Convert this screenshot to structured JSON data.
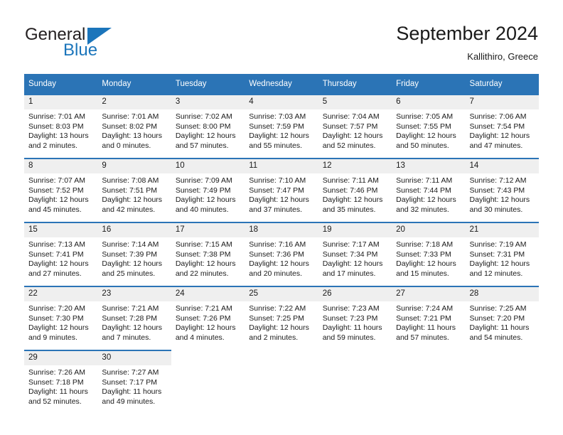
{
  "brand": {
    "name_part1": "General",
    "name_part2": "Blue",
    "accent_color": "#1b75bb"
  },
  "header": {
    "title": "September 2024",
    "location": "Kallithiro, Greece"
  },
  "theme": {
    "header_blue": "#2b74b6",
    "daynum_background": "#efefef",
    "text_color": "#1a1a1a"
  },
  "weekday_headers": [
    "Sunday",
    "Monday",
    "Tuesday",
    "Wednesday",
    "Thursday",
    "Friday",
    "Saturday"
  ],
  "weeks": [
    [
      {
        "day": "1",
        "sunrise": "Sunrise: 7:01 AM",
        "sunset": "Sunset: 8:03 PM",
        "daylight": "Daylight: 13 hours and 2 minutes."
      },
      {
        "day": "2",
        "sunrise": "Sunrise: 7:01 AM",
        "sunset": "Sunset: 8:02 PM",
        "daylight": "Daylight: 13 hours and 0 minutes."
      },
      {
        "day": "3",
        "sunrise": "Sunrise: 7:02 AM",
        "sunset": "Sunset: 8:00 PM",
        "daylight": "Daylight: 12 hours and 57 minutes."
      },
      {
        "day": "4",
        "sunrise": "Sunrise: 7:03 AM",
        "sunset": "Sunset: 7:59 PM",
        "daylight": "Daylight: 12 hours and 55 minutes."
      },
      {
        "day": "5",
        "sunrise": "Sunrise: 7:04 AM",
        "sunset": "Sunset: 7:57 PM",
        "daylight": "Daylight: 12 hours and 52 minutes."
      },
      {
        "day": "6",
        "sunrise": "Sunrise: 7:05 AM",
        "sunset": "Sunset: 7:55 PM",
        "daylight": "Daylight: 12 hours and 50 minutes."
      },
      {
        "day": "7",
        "sunrise": "Sunrise: 7:06 AM",
        "sunset": "Sunset: 7:54 PM",
        "daylight": "Daylight: 12 hours and 47 minutes."
      }
    ],
    [
      {
        "day": "8",
        "sunrise": "Sunrise: 7:07 AM",
        "sunset": "Sunset: 7:52 PM",
        "daylight": "Daylight: 12 hours and 45 minutes."
      },
      {
        "day": "9",
        "sunrise": "Sunrise: 7:08 AM",
        "sunset": "Sunset: 7:51 PM",
        "daylight": "Daylight: 12 hours and 42 minutes."
      },
      {
        "day": "10",
        "sunrise": "Sunrise: 7:09 AM",
        "sunset": "Sunset: 7:49 PM",
        "daylight": "Daylight: 12 hours and 40 minutes."
      },
      {
        "day": "11",
        "sunrise": "Sunrise: 7:10 AM",
        "sunset": "Sunset: 7:47 PM",
        "daylight": "Daylight: 12 hours and 37 minutes."
      },
      {
        "day": "12",
        "sunrise": "Sunrise: 7:11 AM",
        "sunset": "Sunset: 7:46 PM",
        "daylight": "Daylight: 12 hours and 35 minutes."
      },
      {
        "day": "13",
        "sunrise": "Sunrise: 7:11 AM",
        "sunset": "Sunset: 7:44 PM",
        "daylight": "Daylight: 12 hours and 32 minutes."
      },
      {
        "day": "14",
        "sunrise": "Sunrise: 7:12 AM",
        "sunset": "Sunset: 7:43 PM",
        "daylight": "Daylight: 12 hours and 30 minutes."
      }
    ],
    [
      {
        "day": "15",
        "sunrise": "Sunrise: 7:13 AM",
        "sunset": "Sunset: 7:41 PM",
        "daylight": "Daylight: 12 hours and 27 minutes."
      },
      {
        "day": "16",
        "sunrise": "Sunrise: 7:14 AM",
        "sunset": "Sunset: 7:39 PM",
        "daylight": "Daylight: 12 hours and 25 minutes."
      },
      {
        "day": "17",
        "sunrise": "Sunrise: 7:15 AM",
        "sunset": "Sunset: 7:38 PM",
        "daylight": "Daylight: 12 hours and 22 minutes."
      },
      {
        "day": "18",
        "sunrise": "Sunrise: 7:16 AM",
        "sunset": "Sunset: 7:36 PM",
        "daylight": "Daylight: 12 hours and 20 minutes."
      },
      {
        "day": "19",
        "sunrise": "Sunrise: 7:17 AM",
        "sunset": "Sunset: 7:34 PM",
        "daylight": "Daylight: 12 hours and 17 minutes."
      },
      {
        "day": "20",
        "sunrise": "Sunrise: 7:18 AM",
        "sunset": "Sunset: 7:33 PM",
        "daylight": "Daylight: 12 hours and 15 minutes."
      },
      {
        "day": "21",
        "sunrise": "Sunrise: 7:19 AM",
        "sunset": "Sunset: 7:31 PM",
        "daylight": "Daylight: 12 hours and 12 minutes."
      }
    ],
    [
      {
        "day": "22",
        "sunrise": "Sunrise: 7:20 AM",
        "sunset": "Sunset: 7:30 PM",
        "daylight": "Daylight: 12 hours and 9 minutes."
      },
      {
        "day": "23",
        "sunrise": "Sunrise: 7:21 AM",
        "sunset": "Sunset: 7:28 PM",
        "daylight": "Daylight: 12 hours and 7 minutes."
      },
      {
        "day": "24",
        "sunrise": "Sunrise: 7:21 AM",
        "sunset": "Sunset: 7:26 PM",
        "daylight": "Daylight: 12 hours and 4 minutes."
      },
      {
        "day": "25",
        "sunrise": "Sunrise: 7:22 AM",
        "sunset": "Sunset: 7:25 PM",
        "daylight": "Daylight: 12 hours and 2 minutes."
      },
      {
        "day": "26",
        "sunrise": "Sunrise: 7:23 AM",
        "sunset": "Sunset: 7:23 PM",
        "daylight": "Daylight: 11 hours and 59 minutes."
      },
      {
        "day": "27",
        "sunrise": "Sunrise: 7:24 AM",
        "sunset": "Sunset: 7:21 PM",
        "daylight": "Daylight: 11 hours and 57 minutes."
      },
      {
        "day": "28",
        "sunrise": "Sunrise: 7:25 AM",
        "sunset": "Sunset: 7:20 PM",
        "daylight": "Daylight: 11 hours and 54 minutes."
      }
    ],
    [
      {
        "day": "29",
        "sunrise": "Sunrise: 7:26 AM",
        "sunset": "Sunset: 7:18 PM",
        "daylight": "Daylight: 11 hours and 52 minutes."
      },
      {
        "day": "30",
        "sunrise": "Sunrise: 7:27 AM",
        "sunset": "Sunset: 7:17 PM",
        "daylight": "Daylight: 11 hours and 49 minutes."
      },
      null,
      null,
      null,
      null,
      null
    ]
  ]
}
